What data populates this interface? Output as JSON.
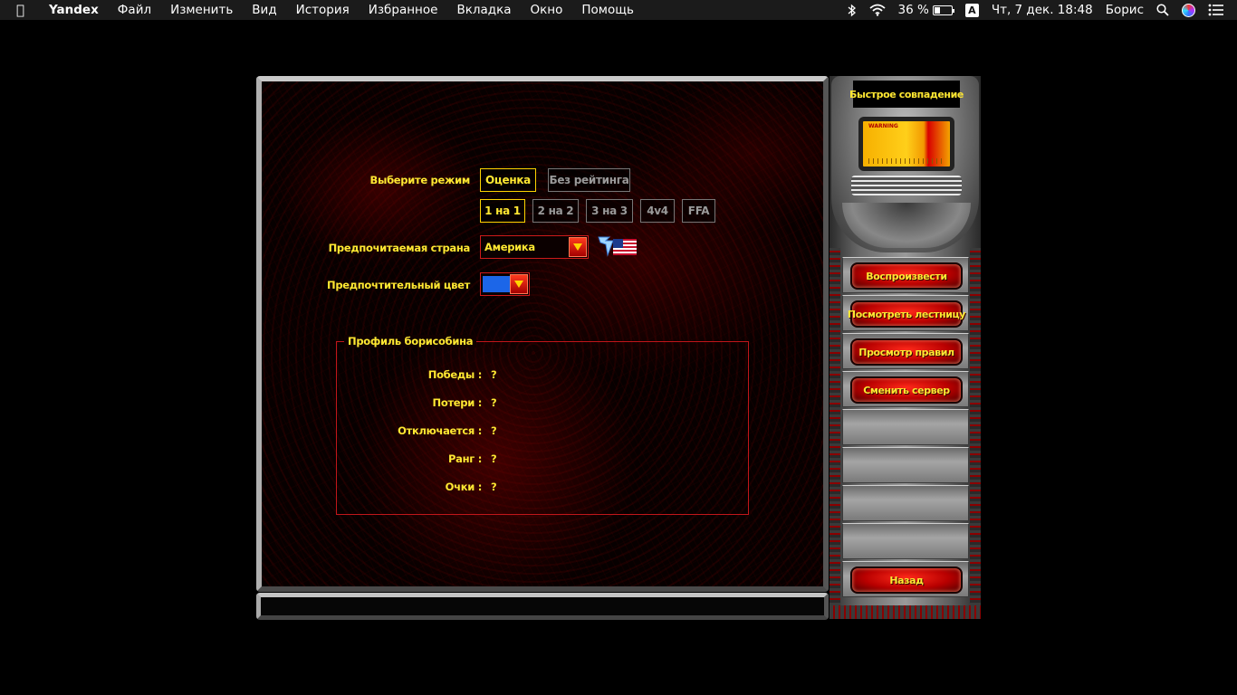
{
  "menubar": {
    "apple_icon": "",
    "app_name": "Yandex",
    "items": [
      "Файл",
      "Изменить",
      "Вид",
      "История",
      "Избранное",
      "Вкладка",
      "Окно",
      "Помощь"
    ],
    "battery_percent": "36 %",
    "battery_level": 0.36,
    "keyboard_layout": "A",
    "datetime": "Чт, 7 дек.  18:48",
    "user": "Борис",
    "icons": [
      "bluetooth-icon",
      "wifi-icon",
      "battery-icon",
      "keyboard-layout-icon",
      "spotlight-search-icon",
      "siri-icon",
      "control-center-icon"
    ]
  },
  "quick_match": {
    "mode_label": "Выберите режим",
    "mode_options": [
      {
        "label": "Оценка",
        "active": true
      },
      {
        "label": "Без рейтинга",
        "active": false
      }
    ],
    "team_size_options": [
      {
        "label": "1 на 1",
        "active": true
      },
      {
        "label": "2 на 2",
        "active": false
      },
      {
        "label": "3 на 3",
        "active": false
      },
      {
        "label": "4v4",
        "active": false
      },
      {
        "label": "FFA",
        "active": false
      }
    ],
    "country_label": "Предпочитаемая страна",
    "country_value": "Америка",
    "color_label": "Предпочтительный цвет",
    "color_value": "#1c66e8",
    "profile": {
      "title": "Профиль борисобина",
      "stats": [
        {
          "label": "Победы :",
          "value": "?"
        },
        {
          "label": "Потери :",
          "value": "?"
        },
        {
          "label": "Отключается :",
          "value": "?"
        },
        {
          "label": "Ранг :",
          "value": "?"
        },
        {
          "label": "Очки :",
          "value": "?"
        }
      ]
    }
  },
  "side_panel": {
    "title": "Быстрое совпадение",
    "screen_warning": "WARNING",
    "buttons": {
      "play": "Воспроизвести",
      "ladder": "Посмотреть лестницу",
      "rules": "Просмотр правил",
      "server": "Сменить сервер",
      "back": "Назад"
    }
  },
  "colors": {
    "accent_text": "#ffe832",
    "frame_red": "#c0161a",
    "button_red": "#d00000"
  }
}
